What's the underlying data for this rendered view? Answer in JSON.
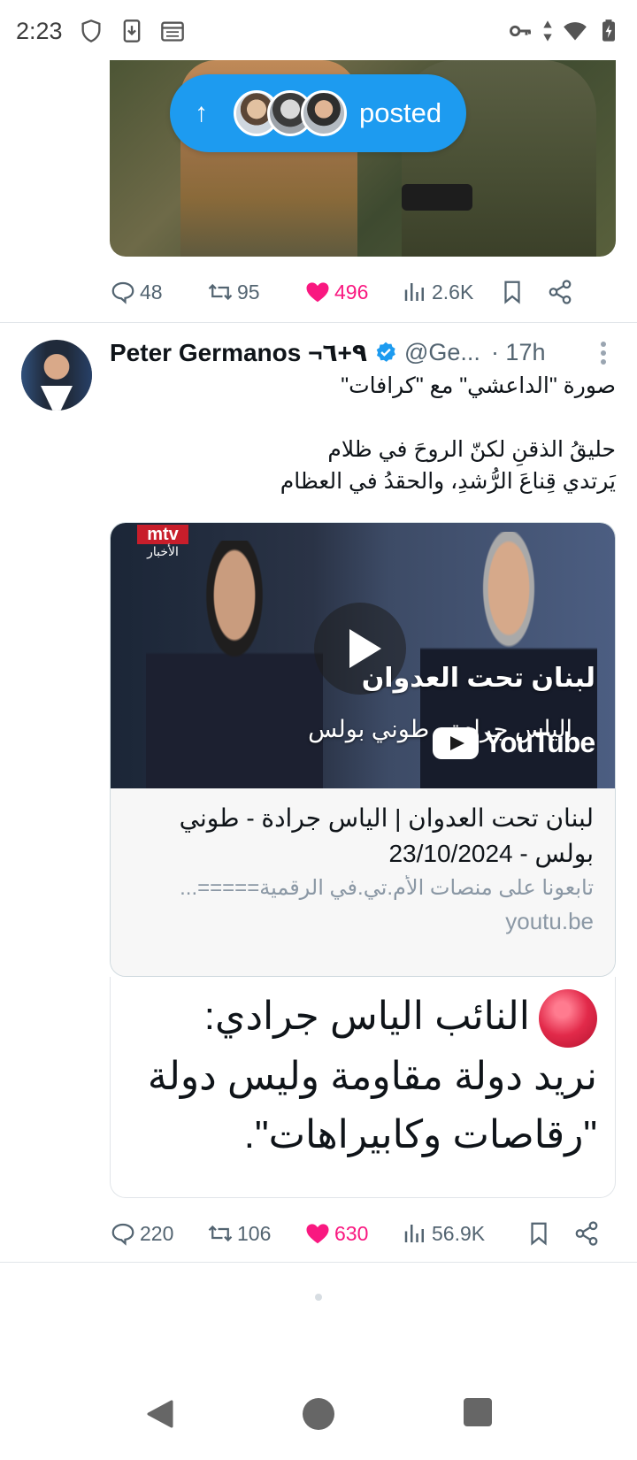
{
  "status_bar": {
    "time": "2:23",
    "left_icons": [
      "shield-icon",
      "download-icon",
      "calendar-icon"
    ],
    "right_icons": [
      "vpn-key-icon",
      "data-arrows-icon",
      "wifi-icon",
      "battery-icon"
    ]
  },
  "posted_pill": {
    "arrow": "↑",
    "label": "posted"
  },
  "prev_tweet": {
    "actions": {
      "replies": "48",
      "reposts": "95",
      "likes": "496",
      "views": "2.6K"
    }
  },
  "tweet": {
    "name": "Peter Germanos ¬٩+٦",
    "handle": "@Ge...",
    "time": "· 17h",
    "text_line1": "صورة \"الداعشي\" مع \"كرافات\"",
    "text_line2": "حليقُ الذقنِ لكنّ الروحَ في ظلام",
    "text_line3": "يَرتدي قِناعَ الرُّشدِ، والحقدُ في العظام",
    "card": {
      "logo_top": "mtv",
      "logo_bottom": "الأخبار",
      "thumb_title": "لبنان تحت العدوان",
      "thumb_sub": "الياس جرادة - طوني بولس",
      "yt_word": "YouTube",
      "title": "لبنان تحت العدوان | الياس جرادة - طوني بولس - 23/10/2024",
      "desc": "تابعونا على منصات الأم.تي.في الرقمية=====...",
      "domain": "youtu.be"
    },
    "quote": {
      "line1": "النائب الياس جرادي:",
      "line2": "نريد دولة مقاومة وليس دولة",
      "line3": "\"رقاصات وكابيراهات\"."
    },
    "actions": {
      "replies": "220",
      "reposts": "106",
      "likes": "630",
      "views": "56.9K"
    }
  },
  "colors": {
    "accent": "#1d9bf0",
    "like": "#f91880",
    "muted": "#536471"
  }
}
